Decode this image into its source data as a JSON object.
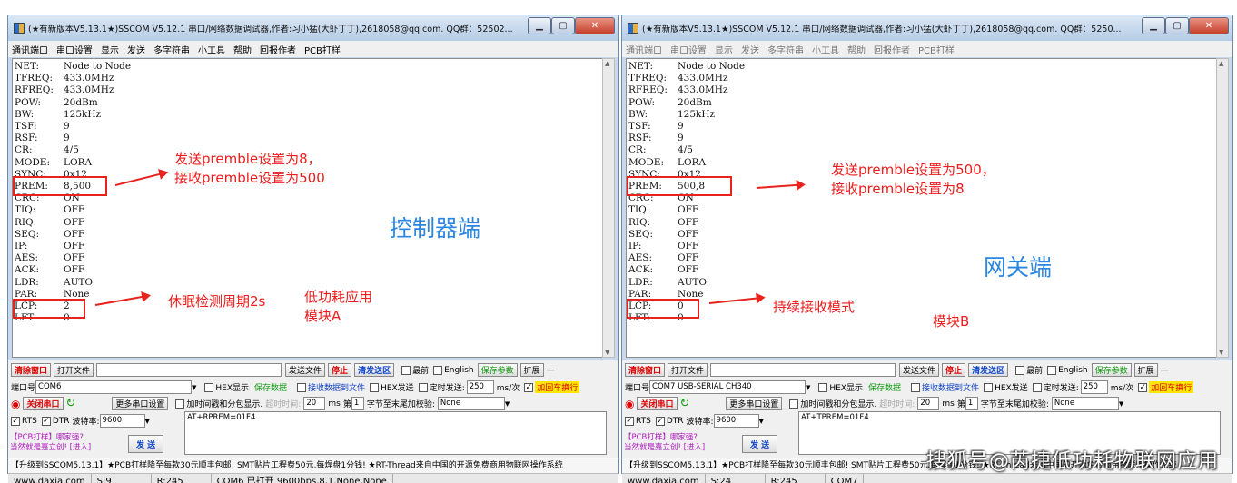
{
  "left": {
    "title": "(★有新版本V5.13.1★)SSCOM V5.12.1 串口/网络数据调试器,作者:习小猛(大虾丁丁),2618058@qq.com. QQ群：52502...",
    "menu": [
      "通讯端口",
      "串口设置",
      "显示",
      "发送",
      "多字符串",
      "小工具",
      "帮助",
      "回报作者",
      "PCB打样"
    ],
    "terminal": [
      {
        "k": "NET:",
        "v": "Node to Node"
      },
      {
        "k": "TFREQ:",
        "v": "433.0MHz"
      },
      {
        "k": "RFREQ:",
        "v": "433.0MHz"
      },
      {
        "k": "POW:",
        "v": "20dBm"
      },
      {
        "k": "BW:",
        "v": "125kHz"
      },
      {
        "k": "TSF:",
        "v": "9"
      },
      {
        "k": "RSF:",
        "v": "9"
      },
      {
        "k": "CR:",
        "v": "4/5"
      },
      {
        "k": "MODE:",
        "v": "LORA"
      },
      {
        "k": "SYNC:",
        "v": "0x12"
      },
      {
        "k": "PREM:",
        "v": "8,500"
      },
      {
        "k": "CRC:",
        "v": "ON"
      },
      {
        "k": "TIQ:",
        "v": "OFF"
      },
      {
        "k": "RIQ:",
        "v": "OFF"
      },
      {
        "k": "SEQ:",
        "v": "OFF"
      },
      {
        "k": "IP:",
        "v": "OFF"
      },
      {
        "k": "AES:",
        "v": "OFF"
      },
      {
        "k": "ACK:",
        "v": "OFF"
      },
      {
        "k": "LDR:",
        "v": "AUTO"
      },
      {
        "k": "PAR:",
        "v": "None"
      },
      {
        "k": "LCP:",
        "v": "2"
      },
      {
        "k": "LFT:",
        "v": "0"
      }
    ],
    "ann1": [
      "发送premble设置为8，",
      "接收premble设置为500"
    ],
    "ann2": "休眠检测周期2s",
    "ann3": [
      "低功耗应用",
      "模块A"
    ],
    "big_label": "控制器端",
    "port": "COM6",
    "send_text": "AT+RPREM=01F4",
    "status": [
      "www.daxia.com",
      "S:9",
      "R:245",
      "COM6 已打开  9600bps,8,1,None,None"
    ]
  },
  "right": {
    "title": "(★有新版本V5.13.1★)SSCOM V5.12.1 串口/网络数据调试器,作者:习小猛(大虾丁丁),2618058@qq.com. QQ群：5250...",
    "menu": [
      "通讯端口",
      "串口设置",
      "显示",
      "发送",
      "多字符串",
      "小工具",
      "帮助",
      "回报作者",
      "PCB打样"
    ],
    "terminal": [
      {
        "k": "NET:",
        "v": "Node to Node"
      },
      {
        "k": "TFREQ:",
        "v": "433.0MHz"
      },
      {
        "k": "RFREQ:",
        "v": "433.0MHz"
      },
      {
        "k": "POW:",
        "v": "20dBm"
      },
      {
        "k": "BW:",
        "v": "125kHz"
      },
      {
        "k": "TSF:",
        "v": "9"
      },
      {
        "k": "RSF:",
        "v": "9"
      },
      {
        "k": "CR:",
        "v": "4/5"
      },
      {
        "k": "MODE:",
        "v": "LORA"
      },
      {
        "k": "SYNC:",
        "v": "0x12"
      },
      {
        "k": "PREM:",
        "v": "500,8"
      },
      {
        "k": "CRC:",
        "v": "ON"
      },
      {
        "k": "TIQ:",
        "v": "OFF"
      },
      {
        "k": "RIQ:",
        "v": "OFF"
      },
      {
        "k": "SEQ:",
        "v": "OFF"
      },
      {
        "k": "IP:",
        "v": "OFF"
      },
      {
        "k": "AES:",
        "v": "OFF"
      },
      {
        "k": "ACK:",
        "v": "OFF"
      },
      {
        "k": "LDR:",
        "v": "AUTO"
      },
      {
        "k": "PAR:",
        "v": "None"
      },
      {
        "k": "LCP:",
        "v": "0"
      },
      {
        "k": "LFT:",
        "v": "0"
      }
    ],
    "ann1": [
      "发送premble设置为500，",
      "接收premble设置为8"
    ],
    "ann2": "持续接收模式",
    "ann3": [
      "模块B"
    ],
    "big_label": "网关端",
    "port": "COM7 USB-SERIAL CH340",
    "send_text": "AT+TPREM=01F4",
    "status": [
      "www.daxia.com",
      "S:24",
      "R:245",
      "COM7"
    ]
  },
  "common": {
    "clear_window": "清除窗口",
    "open_file": "打开文件",
    "send_file": "发送文件",
    "stop": "停止",
    "clear_send": "清发送区",
    "topmost": "最前",
    "english": "English",
    "save_params": "保存参数",
    "expand": "扩展",
    "minus": "—",
    "port_label": "端口号",
    "hex_show": "HEX显示",
    "save_data": "保存数据",
    "recv_to_file": "接收数据到文件",
    "hex_send": "HEX发送",
    "timed_send": "定时发送:",
    "interval": "250",
    "interval_unit": "ms/次",
    "add_crlf": "加回车换行",
    "close_port": "关闭串口",
    "more_settings": "更多串口设置",
    "timestamp": "加时间戳和分包显示.",
    "timeout_label": "超时时间:",
    "timeout": "20",
    "ms": "ms",
    "page_label": "第",
    "page": "1",
    "checksum": "字节至末尾加校验:",
    "checksum_val": "None",
    "rts": "RTS",
    "dtr": "DTR",
    "baud_label": "波特率:",
    "baud": "9600",
    "pcb_note": "【PCB打样】哪家强?",
    "pcb_note2": "当然就是嘉立创! [进入]",
    "send": "发 送",
    "ticker": "【升级到SSCOM5.13.1】★PCB打样降至每款30元顺丰包邮! SMT贴片工程费50元,每焊盘1分钱! ★RT-Thread来自中国的开源免费商用物联网操作系统"
  },
  "watermark": "搜狐号@芮捷低功耗物联网应用"
}
